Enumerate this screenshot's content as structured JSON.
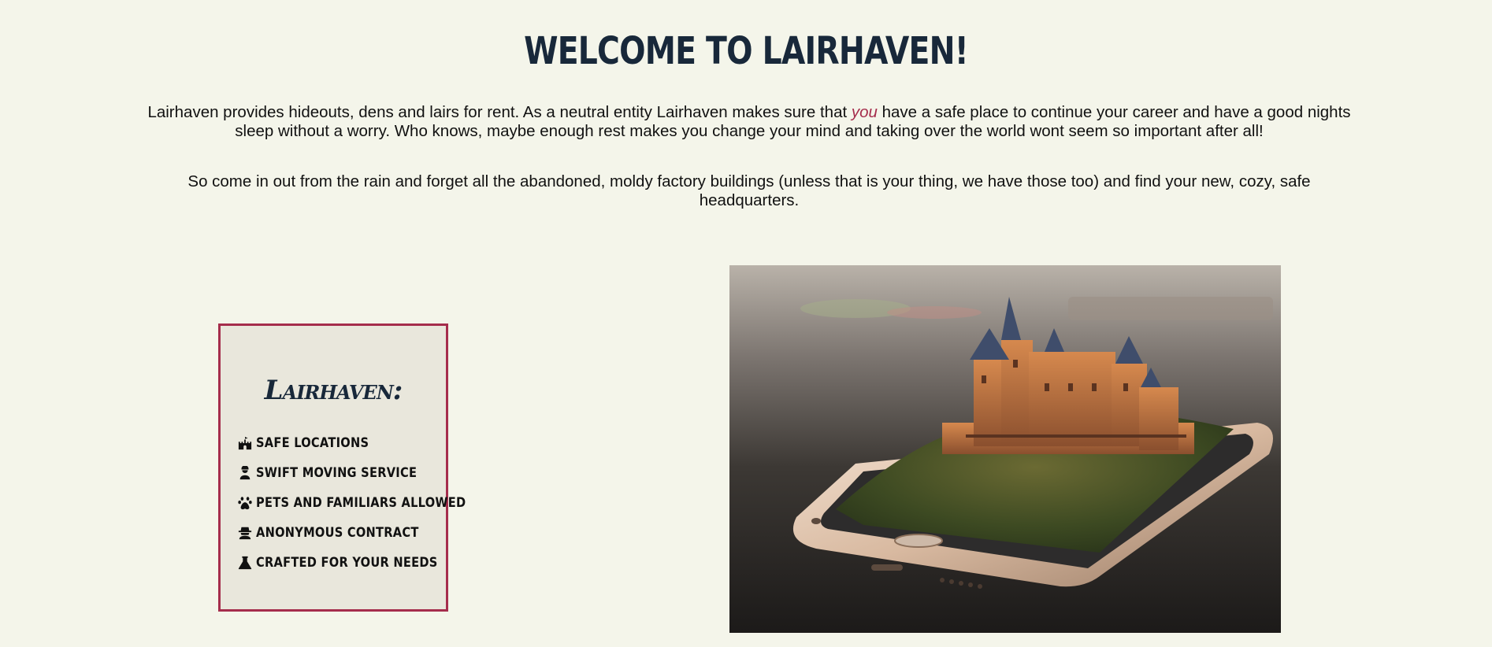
{
  "header": {
    "title": "WELCOME TO LAIRHAVEN!"
  },
  "intro": {
    "p1_before": "Lairhaven provides hideouts, dens and lairs for rent. As a neutral entity Lairhaven makes sure that ",
    "p1_emphasis": "you",
    "p1_after": " have a safe place to continue your career and have a good nights sleep without a worry. Who knows, maybe enough rest makes you change your mind and taking over the world wont seem so important after all!",
    "p2": "So come in out from the rain and forget all the abandoned, moldy factory buildings (unless that is your thing, we have those too) and find your new, cozy, safe headquarters."
  },
  "card": {
    "title": "Lairhaven:",
    "features": [
      {
        "icon": "castle-icon",
        "label": "Safe locations"
      },
      {
        "icon": "mover-icon",
        "label": "Swift moving service"
      },
      {
        "icon": "paw-icon",
        "label": "Pets and familiars allowed"
      },
      {
        "icon": "incognito-icon",
        "label": "Anonymous contract"
      },
      {
        "icon": "flask-icon",
        "label": "Crafted for your needs"
      }
    ]
  },
  "hero_image": {
    "subject": "castle-on-smartphone-image"
  },
  "colors": {
    "background": "#f4f5ea",
    "heading": "#18283a",
    "accent": "#a52d4c",
    "card_background": "#e9e7dc"
  }
}
